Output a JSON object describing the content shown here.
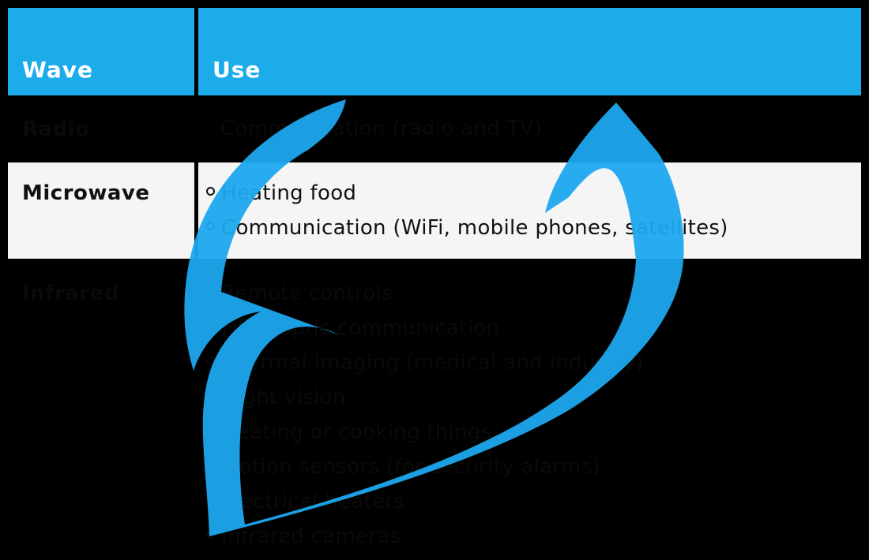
{
  "header": {
    "col_wave": "Wave",
    "col_use": "Use"
  },
  "rows": [
    {
      "wave": "Radio",
      "uses": [
        "Communication (radio and TV)"
      ]
    },
    {
      "wave": "Microwave",
      "uses": [
        "Heating food",
        "Communication (WiFi, mobile phones, satellites)"
      ]
    },
    {
      "wave": "Infrared",
      "uses": [
        "Remote controls",
        "Fibre optic communication",
        "Thermal imaging (medical and industry)",
        "Night vision",
        "Heating or cooking things",
        "Motion sensors (for security alarms)",
        "Electrical heaters",
        "Infrared cameras"
      ]
    }
  ],
  "colors": {
    "header_bg": "#1cacea",
    "header_text": "#ffffff",
    "highlight_row_bg": "#f5f5f5",
    "dark_row_bg": "#000000",
    "watermark": "#1ea8ee"
  },
  "icons": {
    "watermark": "checkmark-logo-icon",
    "bullet": "hollow-circle-bullet-icon"
  }
}
